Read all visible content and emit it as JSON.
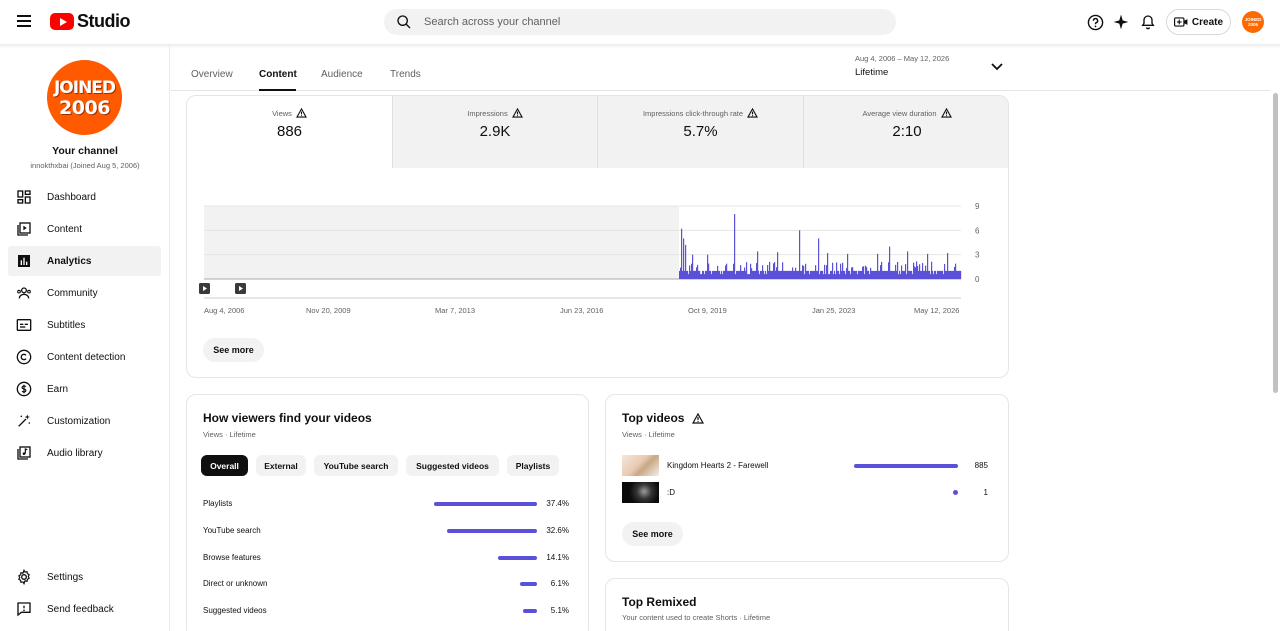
{
  "header": {
    "logo_text": "Studio",
    "search_placeholder": "Search across your channel",
    "create_label": "Create",
    "avatar_text": "JOINED 2006"
  },
  "channel": {
    "avatar_line1": "JOINED",
    "avatar_line2": "2006",
    "title": "Your channel",
    "subtitle": "innokthxbai (Joined Aug 5, 2006)"
  },
  "sidebar": {
    "items": [
      {
        "label": "Dashboard",
        "icon": "dashboard-icon"
      },
      {
        "label": "Content",
        "icon": "content-icon"
      },
      {
        "label": "Analytics",
        "icon": "analytics-icon",
        "active": true
      },
      {
        "label": "Community",
        "icon": "community-icon"
      },
      {
        "label": "Subtitles",
        "icon": "subtitles-icon"
      },
      {
        "label": "Content detection",
        "icon": "copyright-icon"
      },
      {
        "label": "Earn",
        "icon": "dollar-icon"
      },
      {
        "label": "Customization",
        "icon": "magic-wand-icon"
      },
      {
        "label": "Audio library",
        "icon": "audio-library-icon"
      }
    ],
    "bottom": [
      {
        "label": "Settings",
        "icon": "gear-icon"
      },
      {
        "label": "Send feedback",
        "icon": "feedback-icon"
      }
    ]
  },
  "tabs": [
    {
      "label": "Overview"
    },
    {
      "label": "Content",
      "active": true
    },
    {
      "label": "Audience"
    },
    {
      "label": "Trends"
    }
  ],
  "date_range": {
    "range": "Aug 4, 2006 – May 12, 2026",
    "label": "Lifetime"
  },
  "metrics": [
    {
      "label": "Views",
      "value": "886"
    },
    {
      "label": "Impressions",
      "value": "2.9K"
    },
    {
      "label": "Impressions click-through rate",
      "value": "5.7%"
    },
    {
      "label": "Average view duration",
      "value": "2:10"
    }
  ],
  "chart_data": {
    "type": "bar",
    "series": [
      {
        "values_description": "daily views"
      }
    ],
    "x_ticks": [
      "Aug 4, 2006",
      "Nov 20, 2009",
      "Mar 7, 2013",
      "Jun 23, 2016",
      "Oct 9, 2019",
      "Jan 25, 2023",
      "May 12, 2026"
    ],
    "y_ticks": [
      "9",
      "6",
      "3",
      "0"
    ],
    "ylim": [
      0,
      9
    ],
    "color": "#5b51d8",
    "no_data_shading_until": "2019",
    "peaks": [
      {
        "date": "2019-10",
        "value": 5
      },
      {
        "date": "2020-09",
        "value": 8
      },
      {
        "date": "2022-02",
        "value": 6
      },
      {
        "date": "2022-08",
        "value": 5
      },
      {
        "date": "2025-01",
        "value": 4
      }
    ]
  },
  "overview_card": {
    "see_more": "See more"
  },
  "traffic_card": {
    "title": "How viewers find your videos",
    "subtitle": "Views · Lifetime",
    "chips": [
      {
        "label": "Overall",
        "active": true
      },
      {
        "label": "External"
      },
      {
        "label": "YouTube search"
      },
      {
        "label": "Suggested videos"
      },
      {
        "label": "Playlists"
      }
    ],
    "rows": [
      {
        "label": "Playlists",
        "value": "37.4%",
        "pct": 37.4
      },
      {
        "label": "YouTube search",
        "value": "32.6%",
        "pct": 32.6
      },
      {
        "label": "Browse features",
        "value": "14.1%",
        "pct": 14.1
      },
      {
        "label": "Direct or unknown",
        "value": "6.1%",
        "pct": 6.1
      },
      {
        "label": "Suggested videos",
        "value": "5.1%",
        "pct": 5.1
      }
    ]
  },
  "top_videos": {
    "title": "Top videos",
    "subtitle": "Views · Lifetime",
    "rows": [
      {
        "title": "Kingdom Hearts 2 - Farewell",
        "value": "885",
        "fraction": 0.998
      },
      {
        "title": ":D",
        "value": "1",
        "fraction": 0.001
      }
    ],
    "see_more": "See more"
  },
  "top_remixed": {
    "title": "Top Remixed",
    "subtitle": "Your content used to create Shorts · Lifetime"
  }
}
